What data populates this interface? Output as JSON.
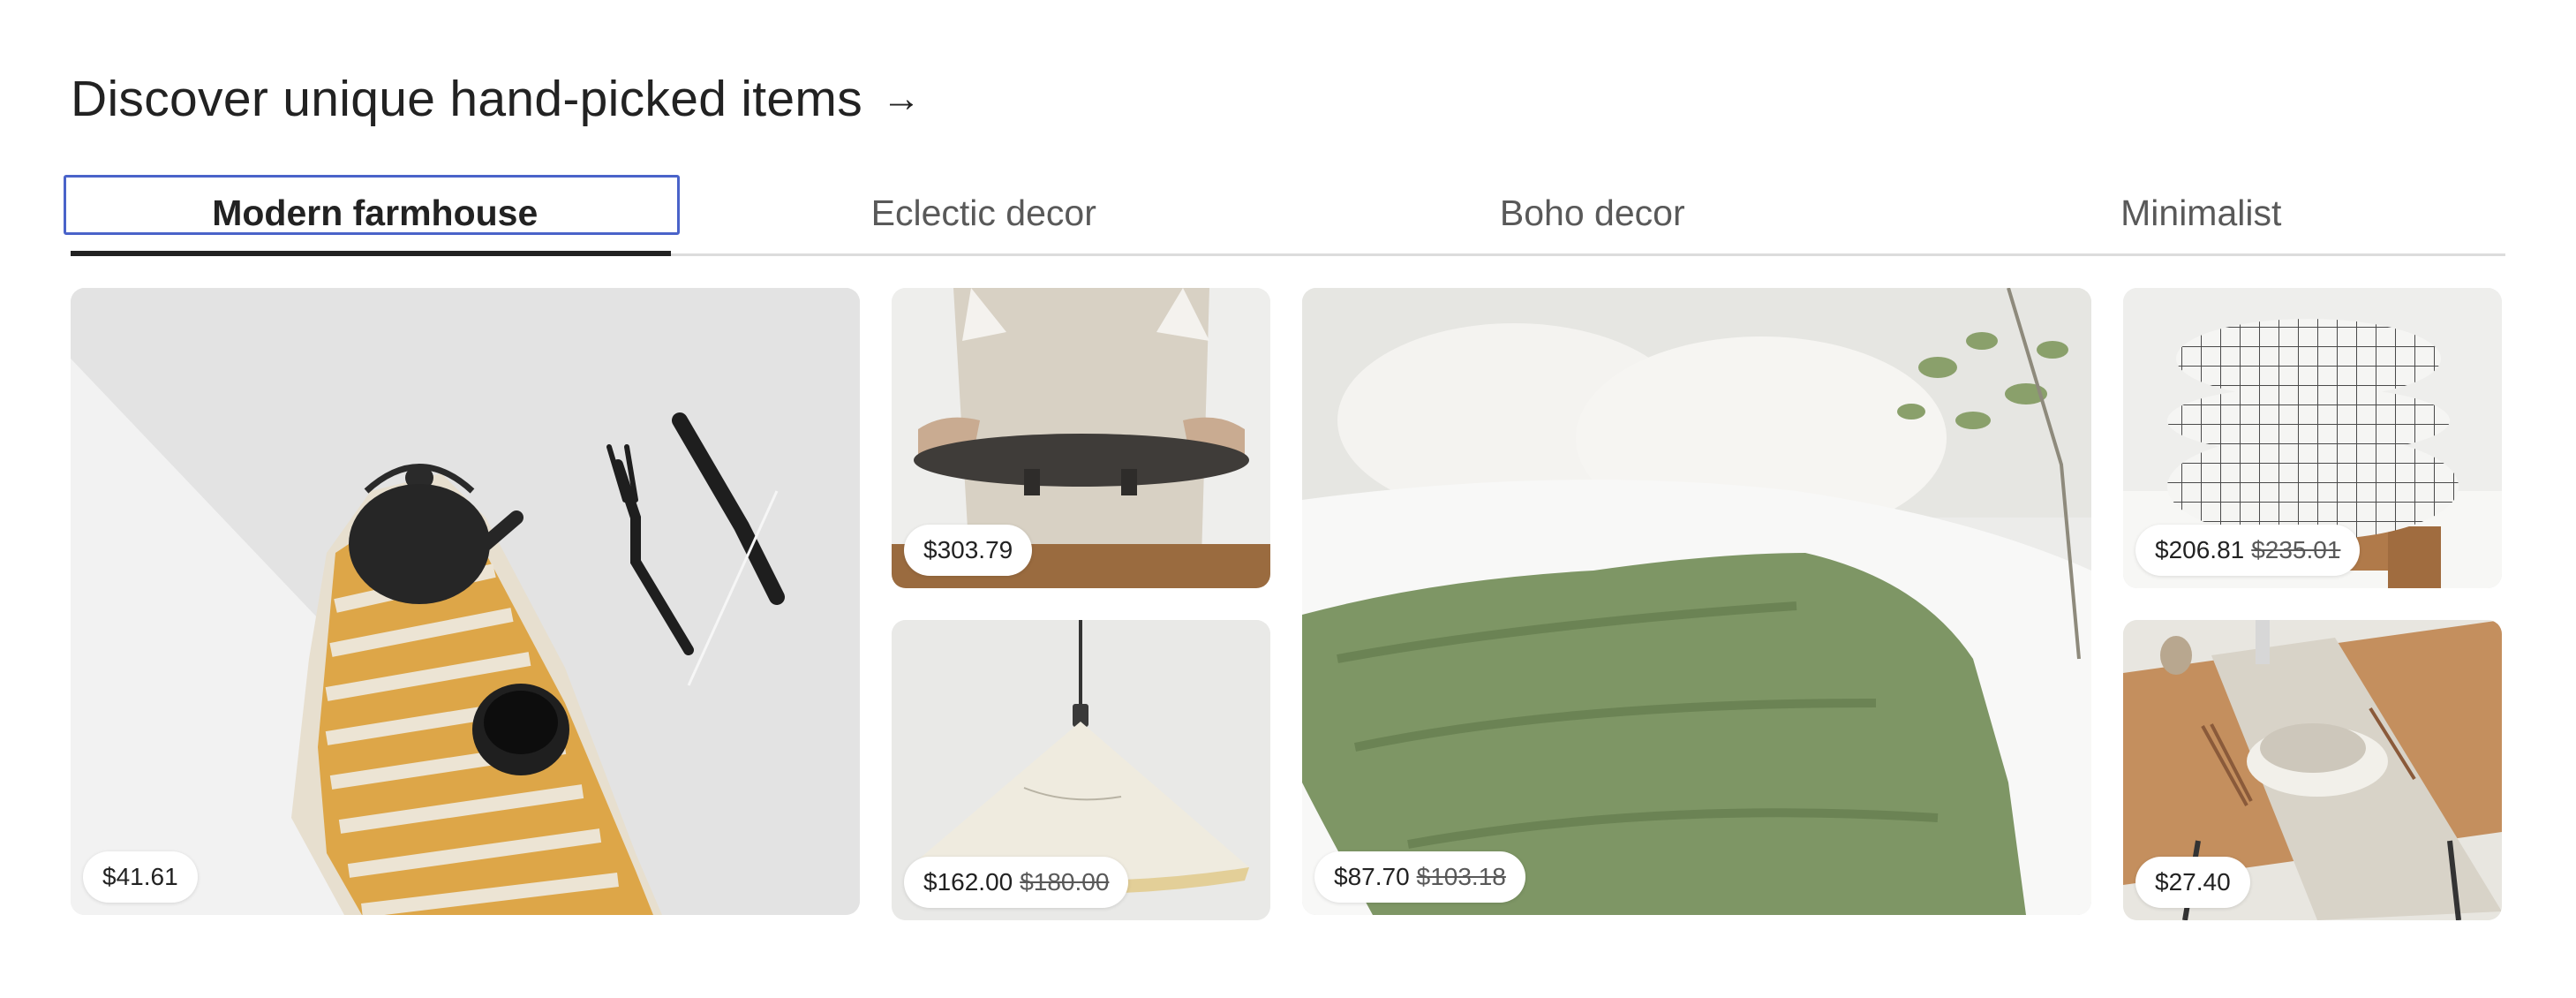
{
  "section": {
    "title": "Discover unique hand-picked items",
    "arrow": "→"
  },
  "tabs": [
    {
      "label": "Modern farmhouse",
      "active": true
    },
    {
      "label": "Eclectic decor",
      "active": false
    },
    {
      "label": "Boho decor",
      "active": false
    },
    {
      "label": "Minimalist",
      "active": false
    }
  ],
  "items": [
    {
      "name": "striped linen towel with cast iron teapot",
      "price": "$41.61",
      "original_price": ""
    },
    {
      "name": "dark wooden serving tray",
      "price": "$303.79",
      "original_price": ""
    },
    {
      "name": "white pendant lamp",
      "price": "$162.00",
      "original_price": "$180.00"
    },
    {
      "name": "green linen throw blanket on bed",
      "price": "$87.70",
      "original_price": "$103.18"
    },
    {
      "name": "checked bedding set",
      "price": "$206.81",
      "original_price": "$235.01"
    },
    {
      "name": "linen table runner and napkin",
      "price": "$27.40",
      "original_price": ""
    }
  ],
  "colors": {
    "text": "#222222",
    "muted_text": "#595959",
    "focus_ring": "#4a63c9",
    "divider": "#dcdcdc",
    "towel_stripe": "#d9a33c",
    "blanket_green": "#7a9160",
    "wood": "#b07a4a"
  }
}
